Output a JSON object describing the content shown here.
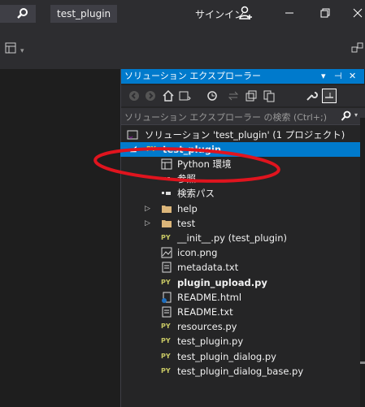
{
  "titlebar": {
    "project_name": "test_plugin",
    "signin_label": "サインイン"
  },
  "panel": {
    "title": "ソリューション エクスプローラー",
    "pin_label": "▾ ⊣ ✕",
    "search_placeholder": "ソリューション エクスプローラー の検索 (Ctrl+;)"
  },
  "tree": {
    "solution": "ソリューション 'test_plugin' (1 プロジェクト)",
    "project": "test_plugin",
    "items": [
      {
        "label": "Python 環境",
        "icon": "environment-icon",
        "bold": false
      },
      {
        "label": "参照",
        "icon": "references-icon",
        "bold": false
      },
      {
        "label": "検索パス",
        "icon": "search-path-icon",
        "bold": false
      },
      {
        "label": "help",
        "icon": "folder-icon",
        "bold": false
      },
      {
        "label": "test",
        "icon": "folder-icon",
        "bold": false
      },
      {
        "label": "__init__.py (test_plugin)",
        "icon": "python-file-icon",
        "bold": false
      },
      {
        "label": "icon.png",
        "icon": "image-file-icon",
        "bold": false
      },
      {
        "label": "metadata.txt",
        "icon": "text-file-icon",
        "bold": false
      },
      {
        "label": "plugin_upload.py",
        "icon": "python-file-icon",
        "bold": true
      },
      {
        "label": "README.html",
        "icon": "html-file-icon",
        "bold": false
      },
      {
        "label": "README.txt",
        "icon": "text-file-icon",
        "bold": false
      },
      {
        "label": "resources.py",
        "icon": "python-file-icon",
        "bold": false
      },
      {
        "label": "test_plugin.py",
        "icon": "python-file-icon",
        "bold": false
      },
      {
        "label": "test_plugin_dialog.py",
        "icon": "python-file-icon",
        "bold": false
      },
      {
        "label": "test_plugin_dialog_base.py",
        "icon": "python-file-icon",
        "bold": false
      }
    ]
  },
  "colors": {
    "accent": "#007acc",
    "annotation": "#e0141e",
    "python_badge": "#c8c864"
  }
}
